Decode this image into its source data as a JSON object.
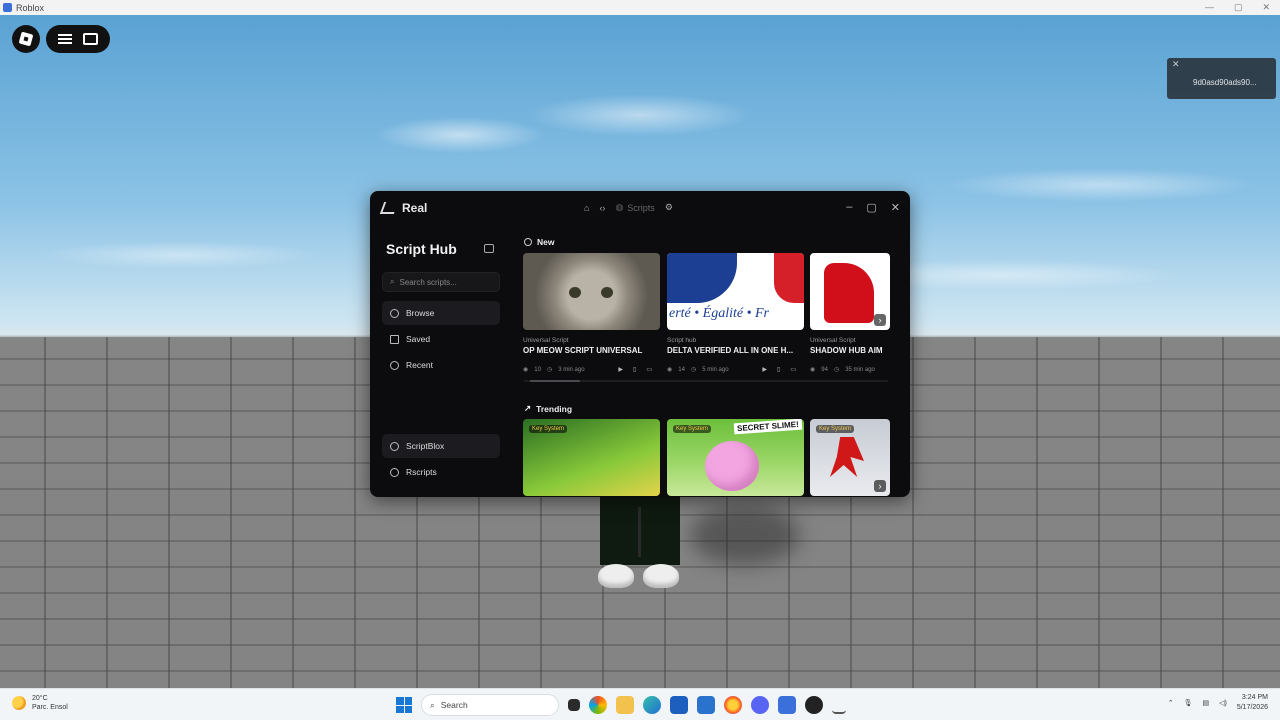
{
  "window": {
    "title": "Roblox"
  },
  "toast": {
    "message": "9d0asd90ads90..."
  },
  "hub": {
    "brand": "Real",
    "nav_scripts_label": "Scripts",
    "sidebar": {
      "title": "Script Hub",
      "search_placeholder": "Search scripts...",
      "items": [
        "Browse",
        "Saved",
        "Recent"
      ],
      "sources": [
        "ScriptBlox",
        "Rscripts"
      ]
    },
    "sections": {
      "new": "New",
      "trending": "Trending"
    },
    "new_cards": [
      {
        "type": "Universal Script",
        "title": "OP MEOW SCRIPT UNIVERSAL",
        "views": "10",
        "time": "3 min ago"
      },
      {
        "type": "Script hub",
        "title": "DELTA VERIFIED ALL IN ONE H...",
        "views": "14",
        "time": "5 min ago"
      },
      {
        "type": "Universal Script",
        "title": "SHADOW HUB AIM",
        "views": "94",
        "time": "35 min ago"
      }
    ],
    "trending_cards": [
      {
        "badge": "Key System"
      },
      {
        "badge": "Key System",
        "banner": "SECRET SLIME!"
      },
      {
        "badge": "Key System"
      }
    ],
    "france_banner_text": "erté • Égalité • Fr"
  },
  "taskbar": {
    "temperature": "20°C",
    "weather": "Parc. Ensol",
    "search_label": "Search",
    "time": "3:24 PM",
    "date": "5/17/2026"
  }
}
